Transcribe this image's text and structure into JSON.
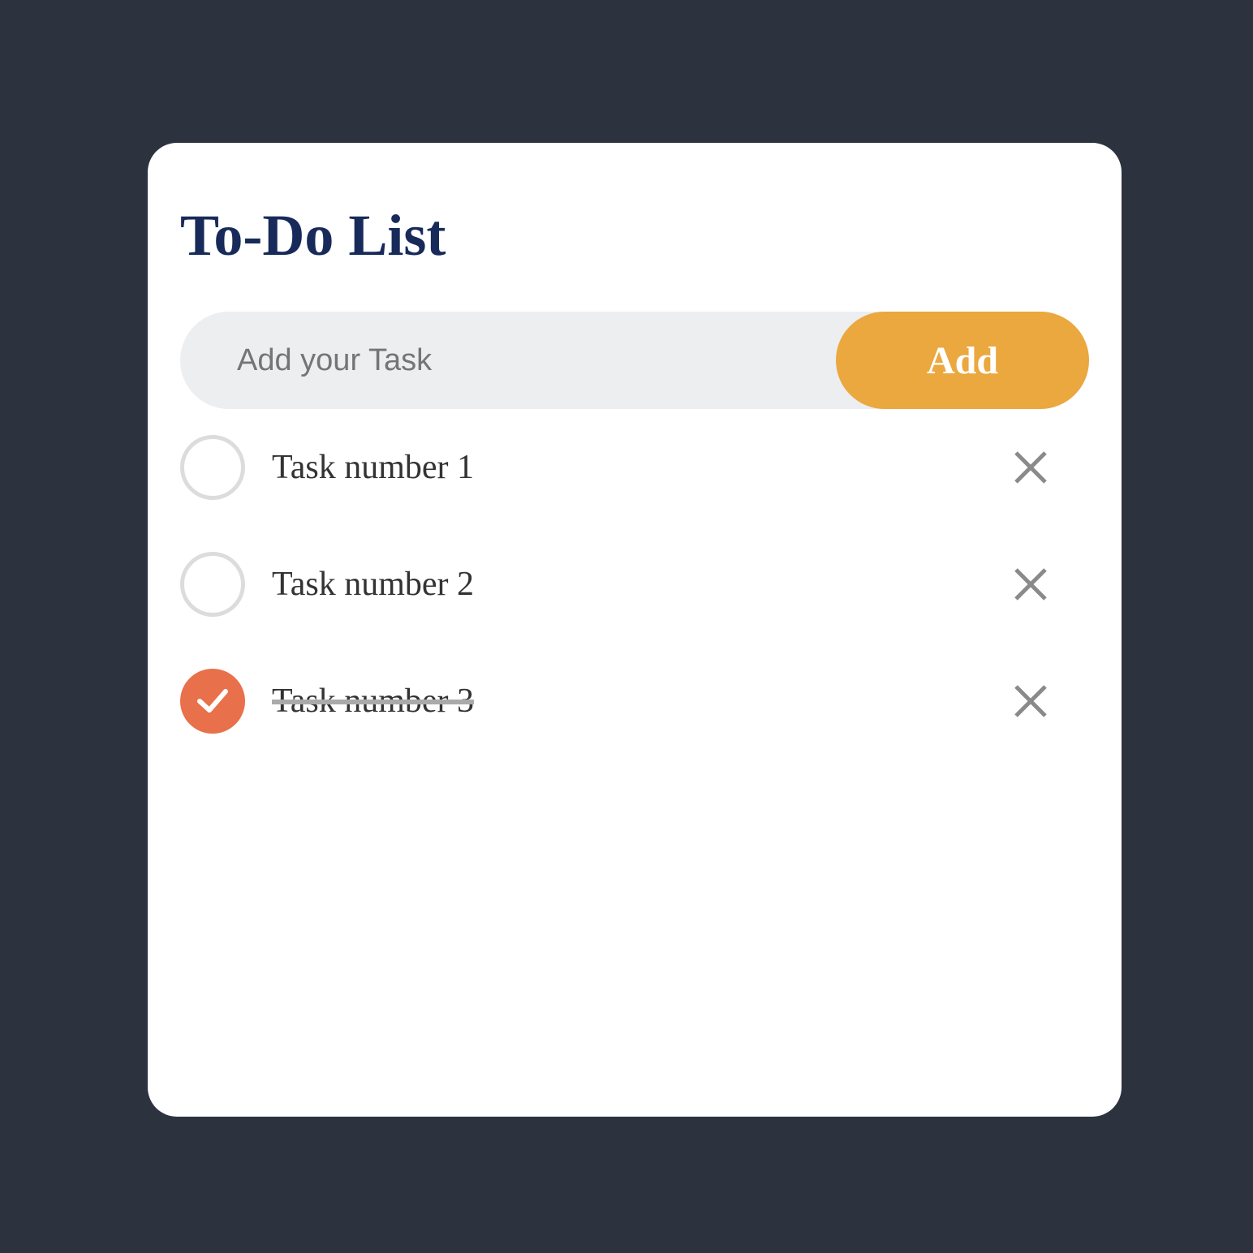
{
  "app": {
    "title": "To-Do List"
  },
  "input": {
    "placeholder": "Add your Task",
    "value": ""
  },
  "add_button": {
    "label": "Add"
  },
  "tasks": [
    {
      "label": "Task number 1",
      "checked": false,
      "icon": "close-icon"
    },
    {
      "label": "Task number 2",
      "checked": false,
      "icon": "close-icon"
    },
    {
      "label": "Task number 3",
      "checked": true,
      "icon": "close-icon"
    }
  ],
  "colors": {
    "background": "#2c323e",
    "card": "#ffffff",
    "title": "#172a5a",
    "input_background": "#edeef0",
    "accent": "#eaa83f",
    "checked": "#e8704a",
    "unchecked_border": "#dcdcdc",
    "delete_icon": "#8a8a8a"
  }
}
